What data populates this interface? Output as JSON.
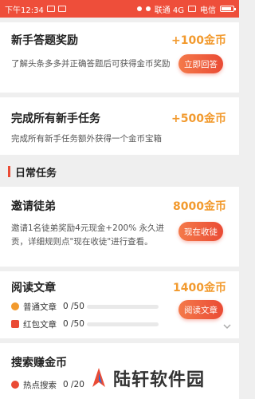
{
  "status_bar": {
    "time": "下午12:34",
    "carrier1": "联通 4G",
    "carrier2": "电信",
    "battery_percent": 0.85
  },
  "cards": {
    "newbie_quiz": {
      "title": "新手答题奖励",
      "reward": "+100金币",
      "desc": "了解头条多多并正确答题后可获得金币奖励",
      "button": "立即回答"
    },
    "newbie_tasks": {
      "title": "完成所有新手任务",
      "reward": "+500金币",
      "desc": "完成所有新手任务额外获得一个金币宝箱"
    }
  },
  "section": {
    "title": "日常任务"
  },
  "invite": {
    "title": "邀请徒弟",
    "reward": "8000金币",
    "desc_line1": "邀请1名徒弟奖励4元现金+200% 永久进",
    "desc_line2": "贡，详细规则点\"现在收徒\"进行查看。",
    "button": "现在收徒"
  },
  "reading": {
    "title": "阅读文章",
    "reward": "1400金币",
    "button": "阅读文章",
    "rows": [
      {
        "label": "普通文章",
        "count": "0 /50",
        "progress": 0,
        "icon": "coin-icon"
      },
      {
        "label": "红包文章",
        "count": "0 /50",
        "progress": 0,
        "icon": "red-envelope-icon"
      }
    ]
  },
  "search_earn": {
    "title": "搜索赚金币",
    "row": {
      "label": "热点搜索",
      "count": "0 /20",
      "icon": "hot-search-icon"
    }
  },
  "watermark": {
    "text": "陆轩软件园"
  },
  "colors": {
    "accent": "#ea4b35",
    "reward": "#f29a2e",
    "status_bar": "#ee4e3a"
  }
}
